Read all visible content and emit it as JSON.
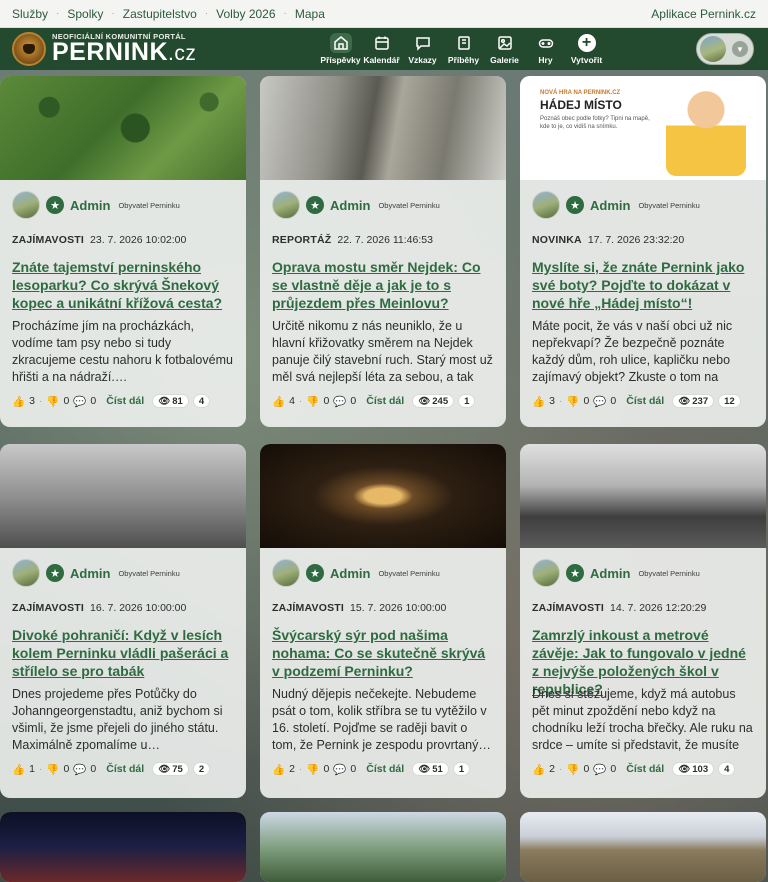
{
  "topbar": {
    "links": [
      "Služby",
      "Spolky",
      "Zastupitelstvo",
      "Volby 2026",
      "Mapa"
    ],
    "app_link": "Aplikace Pernink.cz"
  },
  "header": {
    "tagline": "NEOFICIÁLNÍ KOMUNITNÍ PORTÁL",
    "brand": "PERNINK",
    "brand_tld": ".cz",
    "nav": [
      {
        "label": "Příspěvky",
        "icon": "home-icon",
        "active": true
      },
      {
        "label": "Kalendář",
        "icon": "calendar-icon",
        "active": false
      },
      {
        "label": "Vzkazy",
        "icon": "chat-icon",
        "active": false
      },
      {
        "label": "Příběhy",
        "icon": "book-icon",
        "active": false
      },
      {
        "label": "Galerie",
        "icon": "image-icon",
        "active": false
      },
      {
        "label": "Hry",
        "icon": "gamepad-icon",
        "active": false
      },
      {
        "label": "Vytvořit",
        "icon": "plus-icon",
        "active": false
      }
    ]
  },
  "common": {
    "author": "Admin",
    "role": "Obyvatel Perninku",
    "read_more": "Číst dál"
  },
  "cards": [
    {
      "category": "ZAJÍMAVOSTI",
      "date": "23. 7. 2026 10:02:00",
      "title": "Znáte tajemství perninského lesoparku? Co skrývá Šnekový kopec a unikátní křížová cesta?",
      "excerpt": "Procházíme jím na procházkách, vodíme tam psy nebo si tudy zkracujeme cestu nahoru k fotbalovému hřišti a na nádraží.…",
      "likes": "3",
      "dislikes": "0",
      "comments": "0",
      "views": "81",
      "count": "4"
    },
    {
      "category": "REPORTÁŽ",
      "date": "22. 7. 2026 11:46:53",
      "title": "Oprava mostu směr Nejdek: Co se vlastně děje a jak je to s průjezdem přes Meinlovu?",
      "excerpt": "Určitě nikomu z nás neuniklo, že u hlavní křižovatky směrem na Nejdek panuje čilý stavební ruch. Starý most už měl svá nejlepší léta za sebou, a tak od…",
      "likes": "4",
      "dislikes": "0",
      "comments": "0",
      "views": "245",
      "count": "1"
    },
    {
      "category": "NOVINKA",
      "date": "17. 7. 2026 23:32:20",
      "title": "Myslíte si, že znáte Pernink jako své boty? Pojďte to dokázat v nové hře „Hádej místo“!",
      "excerpt": "Máte pocit, že vás v naší obci už nic nepřekvapí? Že bezpečně poznáte každý dům, roh ulice, kapličku nebo zajímavý objekt? Zkuste o tom na chvíl…",
      "likes": "3",
      "dislikes": "0",
      "comments": "0",
      "views": "237",
      "count": "12",
      "promo": {
        "line1": "NOVÁ HRA NA PERNINK.CZ",
        "line2": "HÁDEJ MÍSTO",
        "line3": "Poznáš obec podle fotky? Tipni na mapě, kde to je, co vidíš na snímku."
      }
    },
    {
      "category": "ZAJÍMAVOSTI",
      "date": "16. 7. 2026 10:00:00",
      "title": "Divoké pohraničí: Když v lesích kolem Perninku vládli pašeráci a střílelo se pro tabák",
      "excerpt": "Dnes projedeme přes Potůčky do Johanngeorgenstadtu, aniž bychom si všimli, že jsme přejeli do jiného státu. Maximálně zpomalíme u…",
      "likes": "1",
      "dislikes": "0",
      "comments": "0",
      "views": "75",
      "count": "2"
    },
    {
      "category": "ZAJÍMAVOSTI",
      "date": "15. 7. 2026 10:00:00",
      "title": "Švýcarský sýr pod našima nohama: Co se skutečně skrývá v podzemí Perninku?",
      "excerpt": "Nudný dějepis nečekejte. Nebudeme psát o tom, kolik stříbra se tu vytěžilo v 16. století. Pojďme se raději bavit o tom, že Pernink je zespodu provrtaný…",
      "likes": "2",
      "dislikes": "0",
      "comments": "0",
      "views": "51",
      "count": "1"
    },
    {
      "category": "ZAJÍMAVOSTI",
      "date": "14. 7. 2026 12:20:29",
      "title": "Zamrzlý inkoust a metrové závěje: Jak to fungovalo v jedné z nejvýše položených škol v republice?",
      "excerpt": "Dnes si stěžujeme, když má autobus pět minut zpoždění nebo když na chodníku leží trocha břečky. Ale ruku na srdce – umíte si představit, že musíte …",
      "likes": "2",
      "dislikes": "0",
      "comments": "0",
      "views": "103",
      "count": "4"
    }
  ]
}
